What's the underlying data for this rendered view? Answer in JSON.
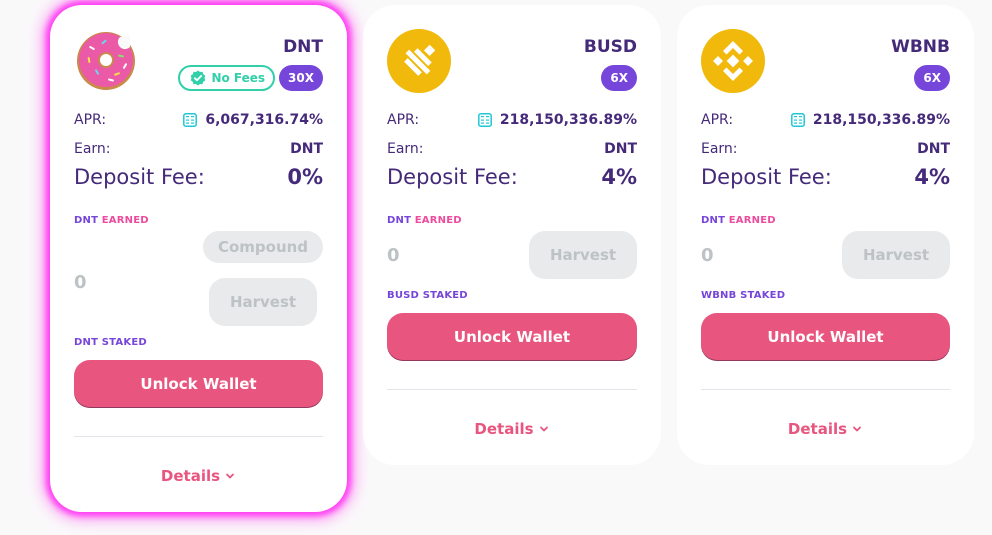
{
  "colors": {
    "primary": "#e8557e",
    "secondary": "#7645d9",
    "success": "#31d0aa",
    "text": "#452a7a",
    "disabled": "#bdc2c4",
    "glow": "#ff3ff3"
  },
  "cards": [
    {
      "token": "DNT",
      "logo_icon": "donut-icon",
      "no_fees_label": "No Fees",
      "multiplier": "30X",
      "apr_label": "APR:",
      "apr_value": "6,067,316.74%",
      "earn_label": "Earn:",
      "earn_value": "DNT",
      "fee_label": "Deposit Fee:",
      "fee_value": "0%",
      "earned_token": "DNT",
      "earned_suffix": "EARNED",
      "earned_value": "0",
      "compound_label": "Compound",
      "harvest_label": "Harvest",
      "staked_token": "DNT",
      "staked_suffix": "STAKED",
      "unlock_label": "Unlock Wallet",
      "details_label": "Details"
    },
    {
      "token": "BUSD",
      "logo_icon": "busd-icon",
      "multiplier": "6X",
      "apr_label": "APR:",
      "apr_value": "218,150,336.89%",
      "earn_label": "Earn:",
      "earn_value": "DNT",
      "fee_label": "Deposit Fee:",
      "fee_value": "4%",
      "earned_token": "DNT",
      "earned_suffix": "EARNED",
      "earned_value": "0",
      "harvest_label": "Harvest",
      "staked_token": "BUSD",
      "staked_suffix": "STAKED",
      "unlock_label": "Unlock Wallet",
      "details_label": "Details"
    },
    {
      "token": "WBNB",
      "logo_icon": "bnb-icon",
      "multiplier": "6X",
      "apr_label": "APR:",
      "apr_value": "218,150,336.89%",
      "earn_label": "Earn:",
      "earn_value": "DNT",
      "fee_label": "Deposit Fee:",
      "fee_value": "4%",
      "earned_token": "DNT",
      "earned_suffix": "EARNED",
      "earned_value": "0",
      "harvest_label": "Harvest",
      "staked_token": "WBNB",
      "staked_suffix": "STAKED",
      "unlock_label": "Unlock Wallet",
      "details_label": "Details"
    }
  ]
}
